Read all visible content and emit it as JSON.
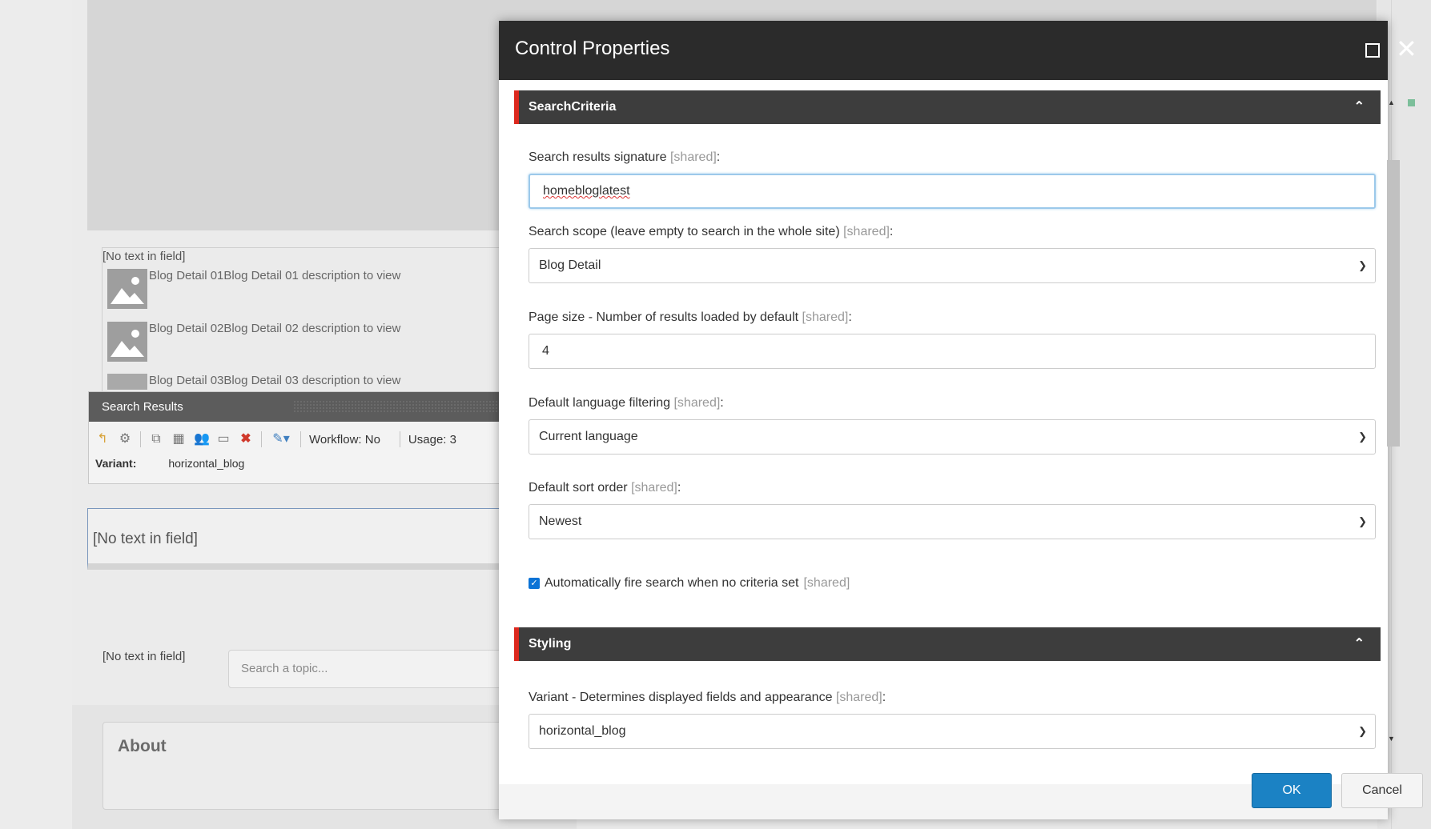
{
  "background": {
    "no_text_1": "[No text in field]",
    "blog_items": [
      "Blog Detail 01Blog Detail 01 description to view",
      "Blog Detail 02Blog Detail 02 description to view",
      "Blog Detail 03Blog Detail 03 description to view"
    ],
    "search_results_panel": {
      "title": "Search Results",
      "workflow": "Workflow: No",
      "usage": "Usage: 3",
      "variant_label": "Variant:",
      "variant_value": "horizontal_blog"
    },
    "no_text_2": "[No text in field]",
    "no_text_3": "[No text in field]",
    "search_placeholder": "Search a topic...",
    "about": "About"
  },
  "dialog": {
    "title": "Control Properties",
    "sections": {
      "search_criteria": "SearchCriteria",
      "styling": "Styling"
    },
    "shared_tag": "[shared]",
    "fields": {
      "signature_label": "Search results signature",
      "signature_value": "homebloglatest",
      "scope_label": "Search scope (leave empty to search in the whole site)",
      "scope_value": "Blog Detail",
      "page_size_label": "Page size - Number of results loaded by default",
      "page_size_value": "4",
      "language_label": "Default language filtering",
      "language_value": "Current language",
      "sort_label": "Default sort order",
      "sort_value": "Newest",
      "autofire_label": "Automatically fire search when no criteria set",
      "autofire_checked": true,
      "variant_label": "Variant - Determines displayed fields and appearance",
      "variant_value": "horizontal_blog"
    },
    "buttons": {
      "ok": "OK",
      "cancel": "Cancel"
    }
  }
}
